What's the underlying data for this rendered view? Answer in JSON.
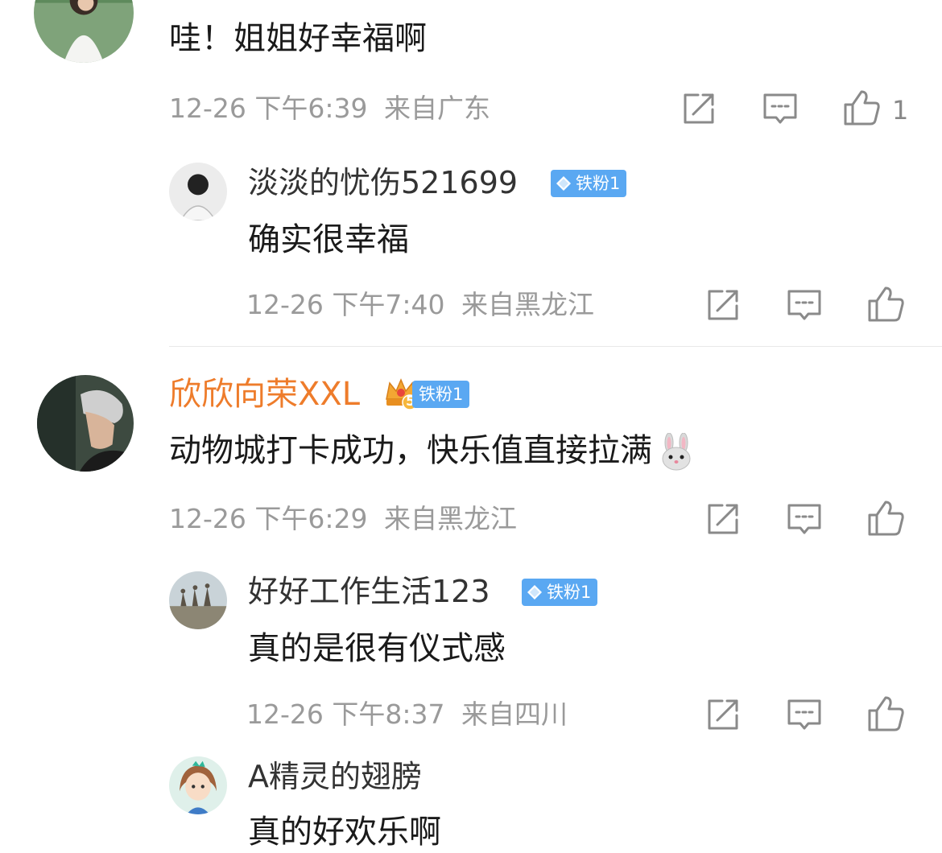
{
  "comments": [
    {
      "text": "哇！姐姐好幸福啊",
      "time": "12-26 下午6:39",
      "location": "来自广东",
      "like_count": "1",
      "replies": [
        {
          "user": "淡淡的忧伤521699",
          "badge": "铁粉1",
          "text": "确实很幸福",
          "time": "12-26 下午7:40",
          "location": "来自黑龙江"
        }
      ]
    },
    {
      "user": "欣欣向荣XXL",
      "badge": "铁粉1",
      "vip_level": "5",
      "text": "动物城打卡成功，快乐值直接拉满",
      "emoji": "rabbit-face",
      "time": "12-26 下午6:29",
      "location": "来自黑龙江",
      "replies": [
        {
          "user": "好好工作生活123",
          "badge": "铁粉1",
          "text": "真的是很有仪式感",
          "time": "12-26 下午8:37",
          "location": "来自四川"
        },
        {
          "user": "A精灵的翅膀",
          "text": "真的好欢乐啊"
        }
      ]
    }
  ],
  "icons": [
    "share-icon",
    "comment-icon",
    "like-icon",
    "diamond-icon",
    "crown-icon"
  ],
  "colors": {
    "username_vip": "#ee7c2b",
    "badge_bg": "#5aa8f2",
    "meta_text": "#9a9a9a",
    "icon_stroke": "#8a8a8a"
  }
}
